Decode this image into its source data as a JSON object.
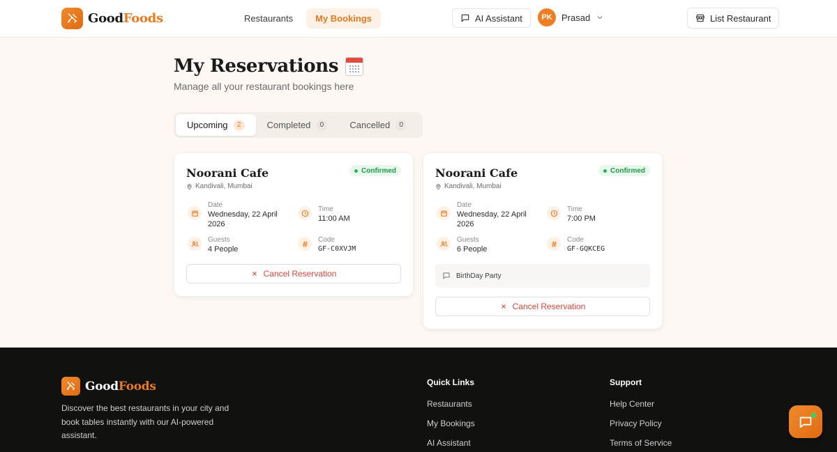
{
  "header": {
    "brand_part1": "Good",
    "brand_part2": "Foods",
    "nav": [
      {
        "label": "Restaurants",
        "active": false
      },
      {
        "label": "My Bookings",
        "active": true
      }
    ],
    "ai_button": "AI Assistant",
    "user": {
      "initials": "PK",
      "name": "Prasad"
    },
    "list_button": "List Restaurant"
  },
  "page": {
    "title": "My Reservations",
    "subtitle": "Manage all your restaurant bookings here"
  },
  "tabs": [
    {
      "label": "Upcoming",
      "count": "2",
      "active": true
    },
    {
      "label": "Completed",
      "count": "0",
      "active": false
    },
    {
      "label": "Cancelled",
      "count": "0",
      "active": false
    }
  ],
  "reservations": [
    {
      "name": "Noorani Cafe",
      "location": "Kandivali, Mumbai",
      "status": "Confirmed",
      "date_label": "Date",
      "date_line1": "Wednesday, 22 April",
      "date_line2": "2026",
      "time_label": "Time",
      "time": "11:00 AM",
      "guests_label": "Guests",
      "guests": "4 People",
      "code_label": "Code",
      "code": "GF-C0XVJM",
      "note": "",
      "cancel_label": "Cancel Reservation"
    },
    {
      "name": "Noorani Cafe",
      "location": "Kandivali, Mumbai",
      "status": "Confirmed",
      "date_label": "Date",
      "date_line1": "Wednesday, 22 April",
      "date_line2": "2026",
      "time_label": "Time",
      "time": "7:00 PM",
      "guests_label": "Guests",
      "guests": "6 People",
      "code_label": "Code",
      "code": "GF-GQKCEG",
      "note": "BirthDay Party",
      "cancel_label": "Cancel Reservation"
    }
  ],
  "footer": {
    "brand_part1": "Good",
    "brand_part2": "Foods",
    "description": "Discover the best restaurants in your city and book tables instantly with our AI-powered assistant.",
    "quick_links_title": "Quick Links",
    "quick_links": [
      "Restaurants",
      "My Bookings",
      "AI Assistant"
    ],
    "support_title": "Support",
    "support_links": [
      "Help Center",
      "Privacy Policy",
      "Terms of Service"
    ]
  },
  "colors": {
    "accent": "#ea7a1f",
    "success": "#26b35a",
    "danger": "#d9453b",
    "footer_bg": "#111110"
  },
  "icons": {
    "brand": "utensils-icon",
    "ai_button": "message-square-icon",
    "user_menu": "chevron-down-icon",
    "list_button": "store-icon",
    "location": "map-pin-icon",
    "date": "calendar-icon",
    "time": "clock-icon",
    "guests": "users-icon",
    "code": "hash-icon",
    "note": "message-square-icon",
    "cancel": "x-icon",
    "chat_fab": "chat-bubble-icon"
  }
}
